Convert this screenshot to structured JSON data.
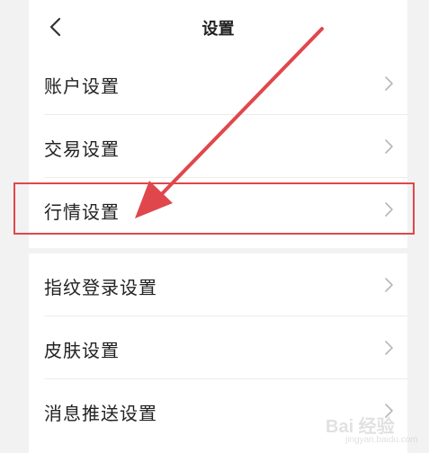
{
  "header": {
    "title": "设置"
  },
  "groups": [
    {
      "items": [
        {
          "label": "账户设置"
        },
        {
          "label": "交易设置"
        },
        {
          "label": "行情设置",
          "highlighted": true
        }
      ]
    },
    {
      "items": [
        {
          "label": "指纹登录设置"
        },
        {
          "label": "皮肤设置"
        },
        {
          "label": "消息推送设置"
        }
      ]
    }
  ],
  "annotation": {
    "color": "#e0474c"
  },
  "watermark": {
    "text": "Bai 经验",
    "sub": "jingyan.baidu.com"
  },
  "icons": {
    "back": "chevron-left-icon",
    "row_chevron": "chevron-right-icon"
  }
}
